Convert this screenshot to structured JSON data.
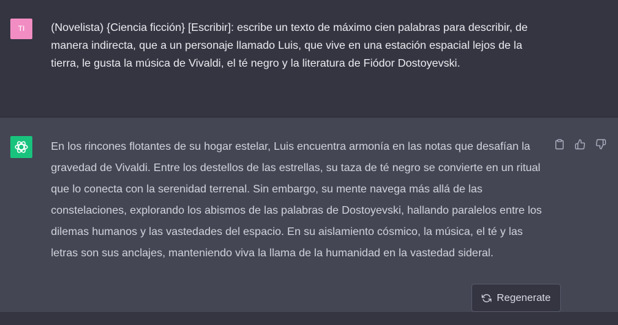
{
  "user": {
    "avatar_initials": "TI",
    "message": "(Novelista) {Ciencia ficción} [Escribir]: escribe un texto de máximo cien palabras para describir, de manera indirecta, que a un personaje llamado Luis, que vive en una estación espacial lejos de la tierra, le gusta la música de Vivaldi, el té negro y la literatura de Fiódor Dostoyevski."
  },
  "assistant": {
    "avatar_icon": "openai-logo-icon",
    "message": "En los rincones flotantes de su hogar estelar, Luis encuentra armonía en las notas que desafían la gravedad de Vivaldi. Entre los destellos de las estrellas, su taza de té negro se convierte en un ritual que lo conecta con la serenidad terrenal. Sin embargo, su mente navega más allá de las constelaciones, explorando los abismos de las palabras de Dostoyevski, hallando paralelos entre los dilemas humanos y las vastedades del espacio. En su aislamiento cósmico, la música, el té y las letras son sus anclajes, manteniendo viva la llama de la humanidad en la vastedad sideral.",
    "actions": [
      "clipboard-icon",
      "thumbs-up-icon",
      "thumbs-down-icon"
    ]
  },
  "regenerate": {
    "label": "Regenerate",
    "icon": "refresh-icon"
  },
  "colors": {
    "user_bg": "#343541",
    "assistant_bg": "#444654",
    "user_avatar": "#f28dc3",
    "bot_avatar": "#19c37d"
  }
}
